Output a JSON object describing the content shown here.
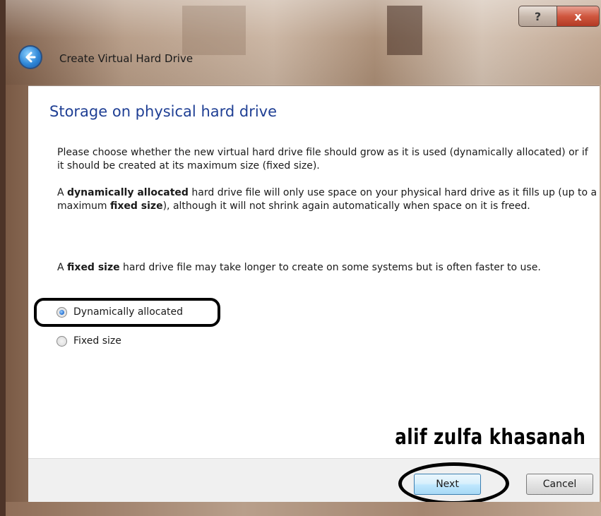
{
  "window": {
    "title": "Create Virtual Hard Drive",
    "help_label": "?",
    "close_label": "x"
  },
  "page": {
    "heading": "Storage on physical hard drive",
    "p1": "Please choose whether the new virtual hard drive file should grow as it is used (dynamically allocated) or if it should be created at its maximum size (fixed size).",
    "p2_a": "A ",
    "p2_b": "dynamically allocated",
    "p2_c": " hard drive file will only use space on your physical hard drive as it fills up (up to a maximum ",
    "p2_d": "fixed size",
    "p2_e": "), although it will not shrink again automatically when space on it is freed.",
    "p3_a": "A ",
    "p3_b": "fixed size",
    "p3_c": " hard drive file may take longer to create on some systems but is often faster to use.",
    "options": [
      {
        "label": "Dynamically allocated",
        "selected": true
      },
      {
        "label": "Fixed size",
        "selected": false
      }
    ],
    "watermark": "alif zulfa khasanah"
  },
  "footer": {
    "next_label": "Next",
    "cancel_label": "Cancel"
  },
  "colors": {
    "heading": "#1f3f94",
    "close_button": "#c4472f"
  }
}
